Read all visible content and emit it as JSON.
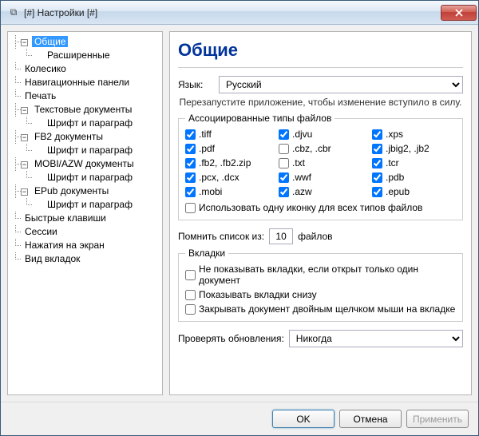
{
  "window": {
    "title": "[#] Настройки [#]"
  },
  "tree": {
    "n0": "Общие",
    "n0_0": "Расширенные",
    "n1": "Колесико",
    "n2": "Навигационные панели",
    "n3": "Печать",
    "n4": "Текстовые документы",
    "n4_0": "Шрифт и параграф",
    "n5": "FB2 документы",
    "n5_0": "Шрифт и параграф",
    "n6": "MOBI/AZW документы",
    "n6_0": "Шрифт и параграф",
    "n7": "EPub документы",
    "n7_0": "Шрифт и параграф",
    "n8": "Быстрые клавиши",
    "n9": "Сессии",
    "n10": "Нажатия на экран",
    "n11": "Вид вкладок"
  },
  "page": {
    "title": "Общие",
    "lang_label": "Язык:",
    "lang_value": "Русский",
    "restart_hint": "Перезапустите приложение, чтобы изменение вступило в силу.",
    "assoc_legend": "Ассоциированные типы файлов",
    "ft": {
      "tiff": ".tiff",
      "djvu": ".djvu",
      "xps": ".xps",
      "pdf": ".pdf",
      "cbz": ".cbz, .cbr",
      "jbig2": ".jbig2, .jb2",
      "fb2": ".fb2, .fb2.zip",
      "txt": ".txt",
      "tcr": ".tcr",
      "pcx": ".pcx, .dcx",
      "wwf": ".wwf",
      "pdb": ".pdb",
      "mobi": ".mobi",
      "azw": ".azw",
      "epub": ".epub"
    },
    "one_icon": "Использовать одну иконку для всех типов файлов",
    "remember_prefix": "Помнить список из:",
    "remember_value": "10",
    "remember_suffix": "файлов",
    "tabs_legend": "Вкладки",
    "tab_hide_single": "Не показывать вкладки, если открыт только один документ",
    "tab_bottom": "Показывать вкладки снизу",
    "tab_dblclose": "Закрывать документ двойным щелчком мыши на вкладке",
    "updates_label": "Проверять обновления:",
    "updates_value": "Никогда"
  },
  "buttons": {
    "ok": "OK",
    "cancel": "Отмена",
    "apply": "Применить"
  }
}
